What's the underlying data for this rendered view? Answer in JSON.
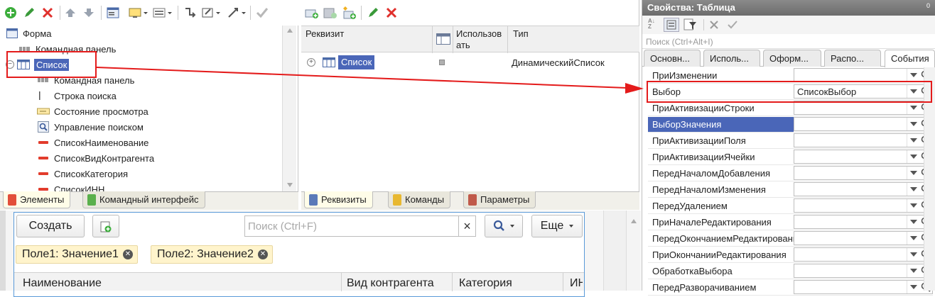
{
  "elements_panel": {
    "tree": [
      {
        "label": "Форма",
        "icon": "form-icon"
      },
      {
        "label": "Командная панель",
        "icon": "command-panel-icon"
      },
      {
        "label": "Список",
        "icon": "table-icon"
      },
      {
        "label": "Командная панель",
        "icon": "command-panel-icon"
      },
      {
        "label": "Строка поиска",
        "icon": "search-string-icon"
      },
      {
        "label": "Состояние просмотра",
        "icon": "view-state-icon"
      },
      {
        "label": "Управление поиском",
        "icon": "search-control-icon"
      },
      {
        "label": "СписокНаименование",
        "icon": "field-icon"
      },
      {
        "label": "СписокВидКонтрагента",
        "icon": "field-icon"
      },
      {
        "label": "СписокКатегория",
        "icon": "field-icon"
      },
      {
        "label": "СписокИНН",
        "icon": "field-icon"
      }
    ],
    "tabs": {
      "elements": "Элементы",
      "command_interface": "Командный интерфейс"
    }
  },
  "attributes_panel": {
    "headers": {
      "attribute": "Реквизит",
      "use": "Использовать",
      "type": "Тип"
    },
    "row": {
      "name": "Список",
      "type": "ДинамическийСписок"
    },
    "tabs": {
      "attributes": "Реквизиты",
      "commands": "Команды",
      "parameters": "Параметры"
    }
  },
  "properties_panel": {
    "title": "Свойства: Таблица",
    "pin": "0",
    "search_placeholder": "Поиск (Ctrl+Alt+I)",
    "tabs": [
      "Основн...",
      "Исполь...",
      "Оформ...",
      "Распо...",
      "События"
    ],
    "events": [
      {
        "name": "ПриИзменении",
        "value": ""
      },
      {
        "name": "Выбор",
        "value": "СписокВыбор"
      },
      {
        "name": "ПриАктивизацииСтроки",
        "value": ""
      },
      {
        "name": "ВыборЗначения",
        "value": ""
      },
      {
        "name": "ПриАктивизацииПоля",
        "value": ""
      },
      {
        "name": "ПриАктивизацииЯчейки",
        "value": ""
      },
      {
        "name": "ПередНачаломДобавления",
        "value": ""
      },
      {
        "name": "ПередНачаломИзменения",
        "value": ""
      },
      {
        "name": "ПередУдалением",
        "value": ""
      },
      {
        "name": "ПриНачалеРедактирования",
        "value": ""
      },
      {
        "name": "ПередОкончаниемРедактирования",
        "value": ""
      },
      {
        "name": "ПриОкончанииРедактирования",
        "value": ""
      },
      {
        "name": "ОбработкаВыбора",
        "value": ""
      },
      {
        "name": "ПередРазворачиванием",
        "value": ""
      }
    ]
  },
  "form_preview": {
    "create_button": "Создать",
    "search_placeholder": "Поиск (Ctrl+F)",
    "clear": "×",
    "more_button": "Еще",
    "filters": [
      "Поле1: Значение1",
      "Поле2: Значение2"
    ],
    "columns": [
      "Наименование",
      "Вид контрагента",
      "Категория",
      "ИН"
    ]
  },
  "colors": {
    "accent": "#4a66b8",
    "highlight": "#e41b1b",
    "panel_bg": "#fffde8"
  }
}
